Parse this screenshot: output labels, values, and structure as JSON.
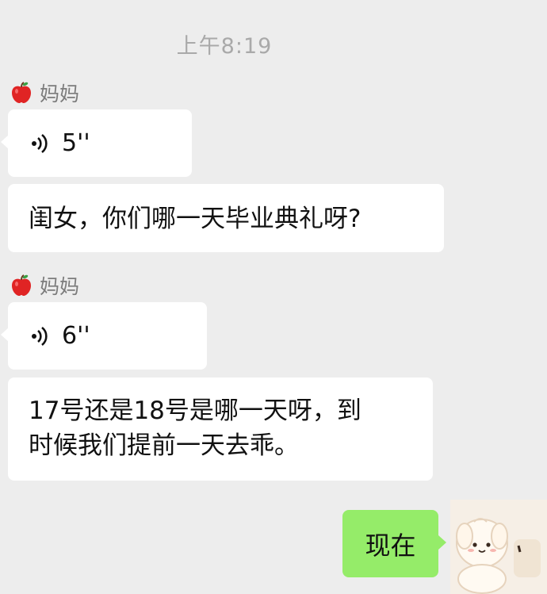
{
  "chat": {
    "timestamp": "上午8:19",
    "messages": [
      {
        "sender": "妈妈",
        "voice_duration": "5''",
        "text": "闺女，你们哪一天毕业典礼呀?"
      },
      {
        "sender": "妈妈",
        "voice_duration": "6''",
        "text_line1": "17号还是18号是哪一天呀，到",
        "text_line2": "时候我们提前一天去乖。"
      }
    ],
    "my_reply": "现在"
  },
  "colors": {
    "background": "#ededed",
    "incoming_bubble": "#ffffff",
    "outgoing_bubble": "#95ec69"
  },
  "icons": [
    "apple-icon",
    "voice-wave-icon",
    "avatar-image"
  ]
}
